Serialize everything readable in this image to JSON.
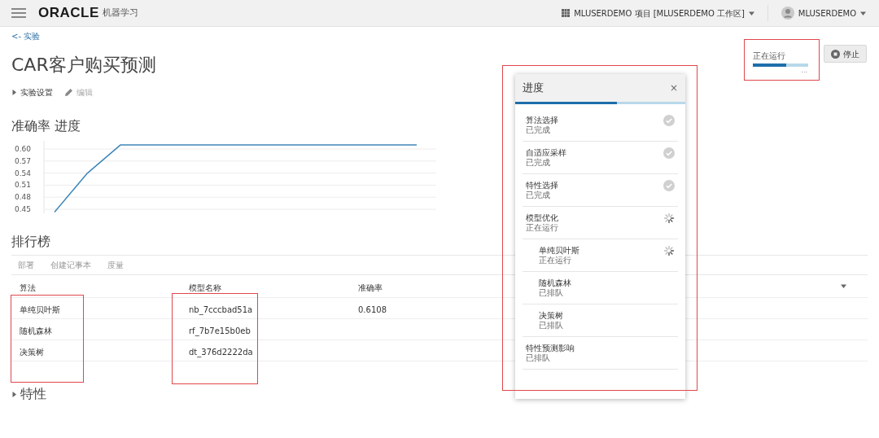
{
  "header": {
    "brand": "ORACLE",
    "product": "机器学习",
    "project": "MLUSERDEMO 项目 [MLUSERDEMO 工作区]",
    "user": "MLUSERDEMO"
  },
  "back_link": "<- 实验",
  "title": "CAR客户购买预测",
  "settings": {
    "label": "实验设置",
    "expanded": false
  },
  "edit": {
    "label": "编辑",
    "disabled": true
  },
  "run_status": {
    "label": "正在运行",
    "level": 0.6,
    "more": "..."
  },
  "stop_button": "停止",
  "accuracy": {
    "title": "准确率 进度",
    "chart_data": {
      "type": "line",
      "grid": true,
      "ylim": [
        0.44,
        0.62
      ],
      "series": [
        {
          "color": "#3f86b8",
          "values": [
            0.443,
            0.54,
            0.61,
            0.61,
            0.61,
            0.61,
            0.61,
            0.61,
            0.61,
            0.61,
            0.61,
            0.61
          ]
        }
      ],
      "yticks": [
        {
          "value": 0.45,
          "label": "0.45"
        },
        {
          "value": 0.48,
          "label": "0.48"
        },
        {
          "value": 0.51,
          "label": "0.51"
        },
        {
          "value": 0.54,
          "label": "0.54"
        },
        {
          "value": 0.57,
          "label": "0.57"
        },
        {
          "value": 0.6,
          "label": "0.60"
        }
      ]
    }
  },
  "leaderboard": {
    "title": "排行榜",
    "actions": [
      {
        "label": "部署",
        "disabled": true
      },
      {
        "label": "创建记事本",
        "disabled": true
      },
      {
        "label": "度量",
        "disabled": true
      }
    ],
    "columns": [
      "算法",
      "模型名称",
      "准确率"
    ],
    "rows": [
      [
        "单纯贝叶斯",
        "nb_7cccbad51a",
        "0.6108"
      ],
      [
        "随机森林",
        "rf_7b7e15b0eb",
        ""
      ],
      [
        "决策树",
        "dt_376d2222da",
        ""
      ]
    ]
  },
  "features": {
    "label": "特性",
    "expanded": false
  },
  "progress_panel": {
    "title": "进度",
    "close": "×",
    "level": 0.6,
    "steps": [
      {
        "name": "算法选择",
        "status": "已完成",
        "kind": "done"
      },
      {
        "name": "自适应采样",
        "status": "已完成",
        "kind": "done"
      },
      {
        "name": "特性选择",
        "status": "已完成",
        "kind": "done"
      },
      {
        "name": "模型优化",
        "status": "正在运行",
        "kind": "running",
        "children": [
          {
            "name": "单纯贝叶斯",
            "status": "正在运行",
            "kind": "running"
          },
          {
            "name": "随机森林",
            "status": "已排队",
            "kind": "queued"
          },
          {
            "name": "决策树",
            "status": "已排队",
            "kind": "queued"
          }
        ]
      },
      {
        "name": "特性预测影响",
        "status": "已排队",
        "kind": "queued"
      }
    ]
  },
  "annotations": [
    {
      "kind": "highlight",
      "color": "#e0474c"
    },
    {
      "kind": "highlight",
      "color": "#e0474c"
    },
    {
      "kind": "highlight",
      "color": "#e0474c"
    },
    {
      "kind": "highlight",
      "color": "#e0474c"
    }
  ]
}
